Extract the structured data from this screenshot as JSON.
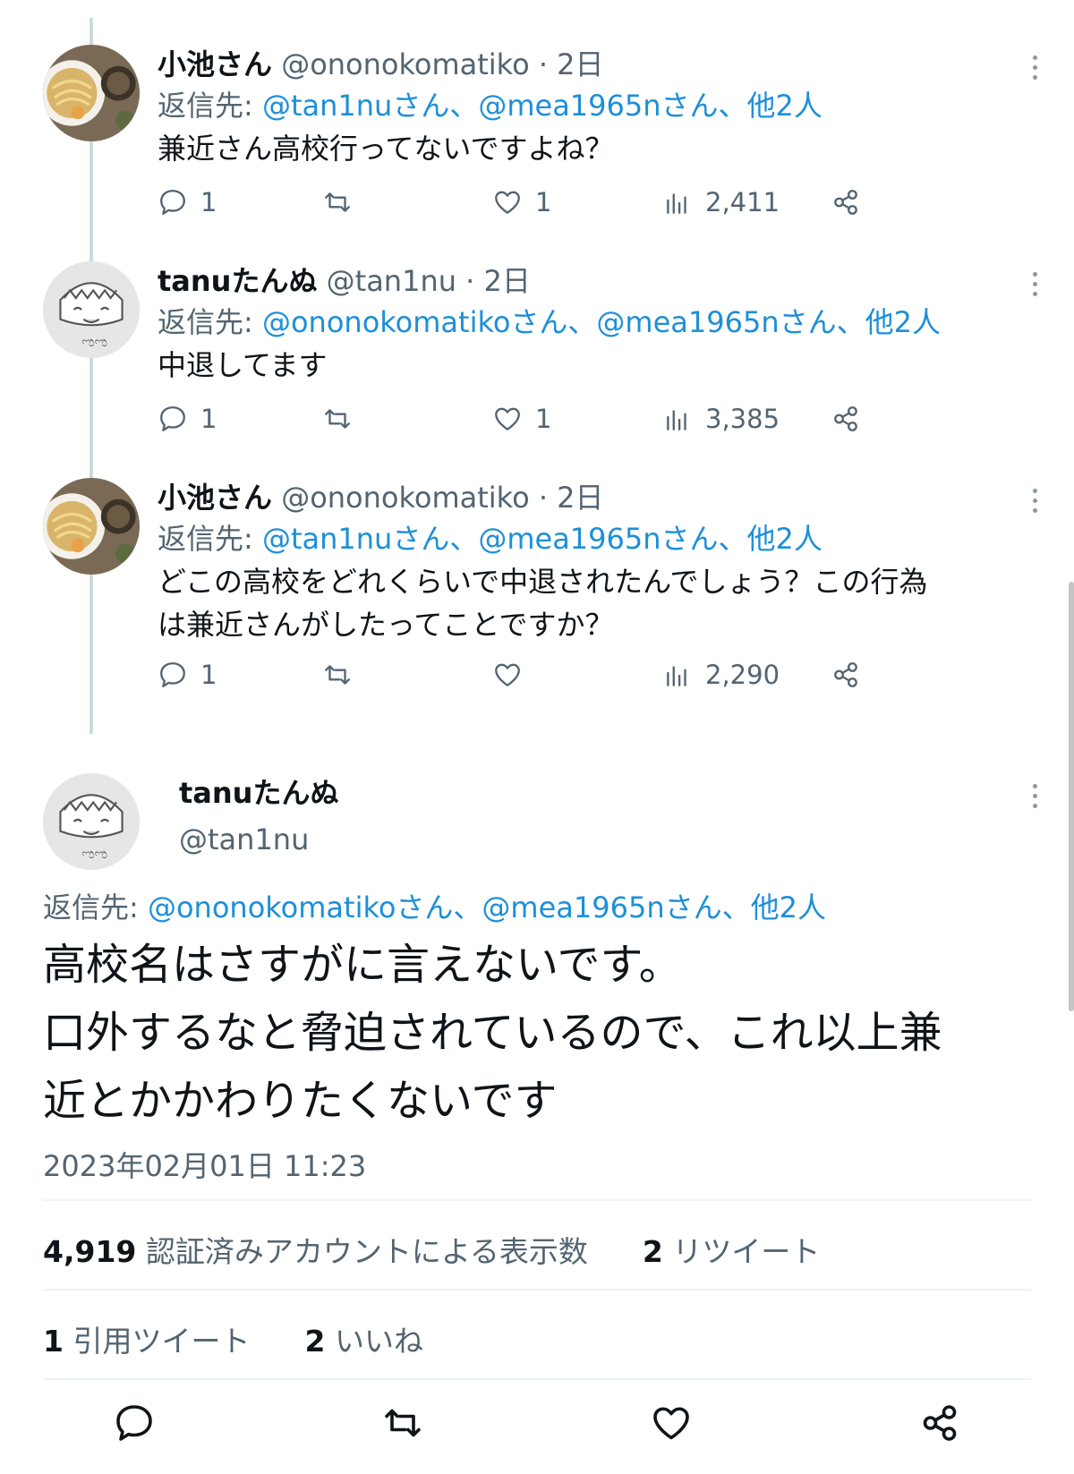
{
  "tweets": [
    {
      "name": "小池さん",
      "handle": "@ononokomatiko",
      "time": "· 2日",
      "reply_prefix": "返信先: ",
      "reply_links": "@tan1nuさん、@mea1965nさん、他2人",
      "text": "兼近さん高校行ってないですよね？",
      "replies": "1",
      "retweets": "",
      "likes": "1",
      "views": "2,411"
    },
    {
      "name": "tanuたんぬ",
      "handle": "@tan1nu",
      "time": "· 2日",
      "reply_prefix": "返信先: ",
      "reply_links": "@ononokomatikoさん、@mea1965nさん、他2人",
      "text": "中退してます",
      "replies": "1",
      "retweets": "",
      "likes": "1",
      "views": "3,385"
    },
    {
      "name": "小池さん",
      "handle": "@ononokomatiko",
      "time": "· 2日",
      "reply_prefix": "返信先: ",
      "reply_links": "@tan1nuさん、@mea1965nさん、他2人",
      "text_line1": "どこの高校をどれくらいで中退されたんでしょう？この行為",
      "text_line2": "は兼近さんがしたってことですか？",
      "replies": "1",
      "retweets": "",
      "likes": "",
      "views": "2,290"
    }
  ],
  "main_tweet": {
    "name": "tanuたんぬ",
    "handle": "@tan1nu",
    "reply_prefix": "返信先: ",
    "reply_links": "@ononokomatikoさん、@mea1965nさん、他2人",
    "text_line1": "高校名はさすがに言えないです。",
    "text_line2": "口外するなと脅迫されているので、これ以上兼",
    "text_line3": "近とかかわりたくないです",
    "timestamp": "2023年02月01日 11:23",
    "views_count": "4,919",
    "views_label": "認証済みアカウントによる表示数",
    "retweets_count": "2",
    "retweets_label": "リツイート",
    "quotes_count": "1",
    "quotes_label": "引用ツイート",
    "likes_count": "2",
    "likes_label": "いいね"
  },
  "icons": {
    "reply": "speech-bubble-icon",
    "retweet": "retweet-arrows-icon",
    "like": "heart-icon",
    "views": "bar-chart-icon",
    "share": "share-icon",
    "more": "vertical-ellipsis-icon"
  },
  "colors": {
    "link": "#1d8fd9",
    "secondary_text": "#536471",
    "primary_text": "#0f1419",
    "thread_line": "#cfd9de"
  }
}
